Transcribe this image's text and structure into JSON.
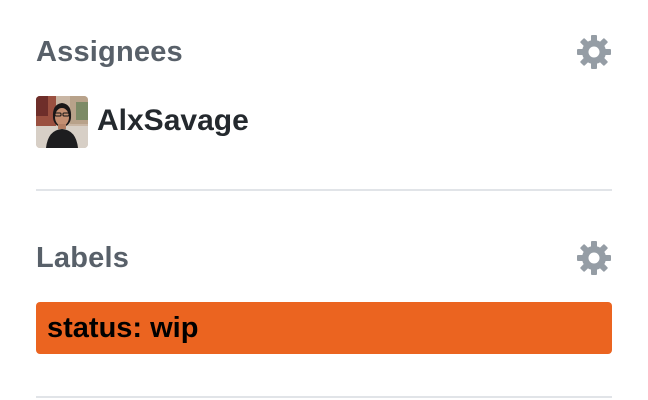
{
  "assignees": {
    "title": "Assignees",
    "settings_icon": "gear-icon",
    "users": [
      {
        "login": "AlxSavage"
      }
    ]
  },
  "labels": {
    "title": "Labels",
    "settings_icon": "gear-icon",
    "items": [
      {
        "name": "status: wip",
        "color": "#eb6420"
      }
    ]
  },
  "colors": {
    "heading": "#586069",
    "text": "#24292e",
    "divider": "#e1e4e8",
    "gear": "#959da5"
  }
}
